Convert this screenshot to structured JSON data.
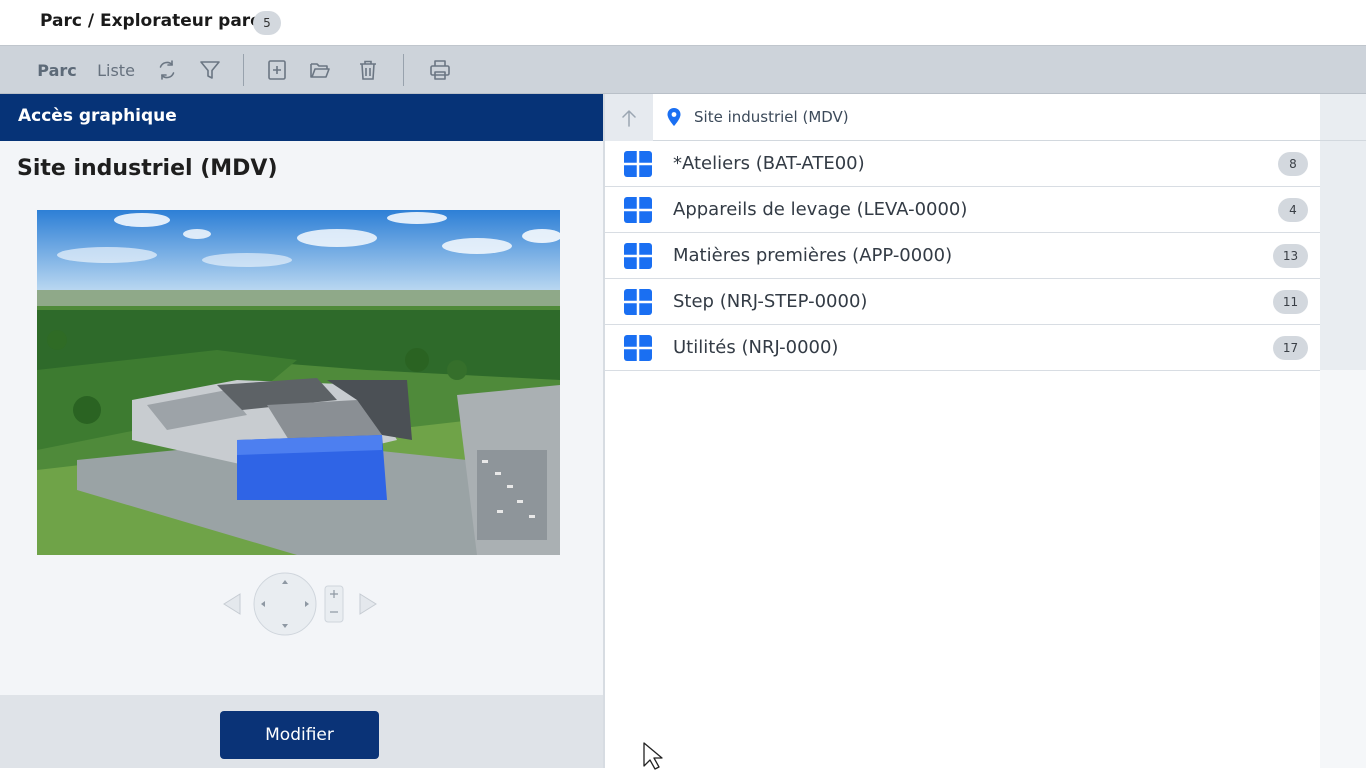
{
  "header": {
    "breadcrumb": "Parc / Explorateur parc",
    "count": "5"
  },
  "toolbar": {
    "parc_label": "Parc",
    "liste_label": "Liste",
    "icons": [
      "refresh-icon",
      "filter-icon",
      "add-icon",
      "open-folder-icon",
      "delete-icon",
      "print-icon"
    ]
  },
  "left_panel": {
    "header": "Accès graphique",
    "site_title": "Site industriel (MDV)",
    "modify_label": "Modifier"
  },
  "right_panel": {
    "path": "Site industriel (MDV)",
    "items": [
      {
        "label": "*Ateliers (BAT-ATE00)",
        "count": "8"
      },
      {
        "label": "Appareils de levage (LEVA-0000)",
        "count": "4"
      },
      {
        "label": "Matières premières (APP-0000)",
        "count": "13"
      },
      {
        "label": "Step (NRJ-STEP-0000)",
        "count": "11"
      },
      {
        "label": "Utilités (NRJ-0000)",
        "count": "17"
      }
    ]
  },
  "colors": {
    "primary": "#063377",
    "accent_blue": "#1a6ff2",
    "toolbar": "#cdd3da"
  }
}
